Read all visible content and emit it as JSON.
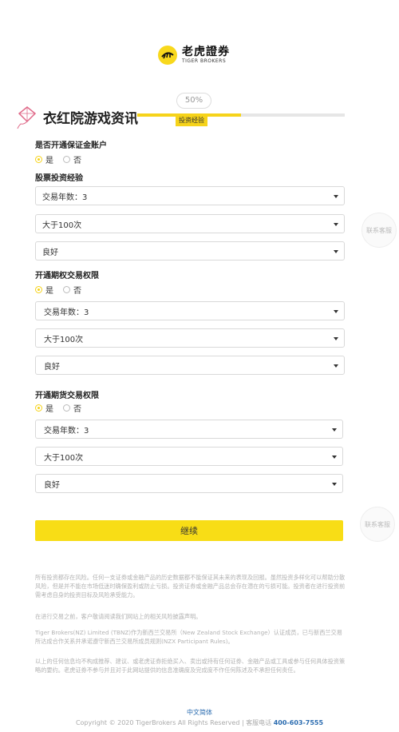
{
  "logo": {
    "name": "老虎證券",
    "sub": "TIGER BROKERS"
  },
  "header": {
    "title": "衣红院游戏资讯",
    "progress_percent": 50,
    "progress_label": "50%",
    "step_label": "投资经验"
  },
  "margin_account": {
    "label": "是否开通保证金账户",
    "yes": "是",
    "no": "否",
    "selected": "yes"
  },
  "stock": {
    "label": "股票投资经验",
    "years": "交易年数：3",
    "count": "大于100次",
    "level": "良好"
  },
  "options": {
    "label": "开通期权交易权限",
    "yes": "是",
    "no": "否",
    "selected": "yes",
    "years": "交易年数：3",
    "count": "大于100次",
    "level": "良好"
  },
  "futures": {
    "label": "开通期货交易权限",
    "yes": "是",
    "no": "否",
    "selected": "yes",
    "years": "交易年数：3",
    "count": "大于100次",
    "level": "良好"
  },
  "side": {
    "contact_label": "联系客服"
  },
  "continue_label": "继续",
  "disclaimer": {
    "p1": "所有投资都存在风险。任何一支证券或金融产品的历史数据都不能保证其未来的表现及回报。虽然投资多样化可以帮助分散风险，但是并不能在市场低迷时确保盈利或防止亏损。投资证券或金融产品总会存在潜在的亏损可能。投资者在进行投资前需考虑自身的投资目标及风险承受能力。",
    "p2": "在进行交易之前，客户敬请阅读我们网站上的相关风险披露声明。",
    "p3": "Tiger Brokers(NZ) Limited (TBNZ)作为新西兰交易所（New Zealand Stock Exchange）认证成员，已与新西兰交易所达成合作关系并承诺遵守新西兰交易所成员规则(NZX Participant Rules)。",
    "p4": "以上的任何信息均不构成推荐、建议、或老虎证券拒绝买入、卖出或持有任何证券、金融产品或工具或参与任何具体投资策略的要约。老虎证券不参与并且对于此网站提供的信息准确度及完成度不作任何陈述及不承担任何责任。"
  },
  "footer": {
    "language": "中文简体",
    "copyright": "Copyright © 2020 TigerBrokers All Rights Reserved | 客服电话",
    "phone": "400-603-7555"
  },
  "colors": {
    "accent": "#f8dd16",
    "link": "#2b6cb0"
  }
}
